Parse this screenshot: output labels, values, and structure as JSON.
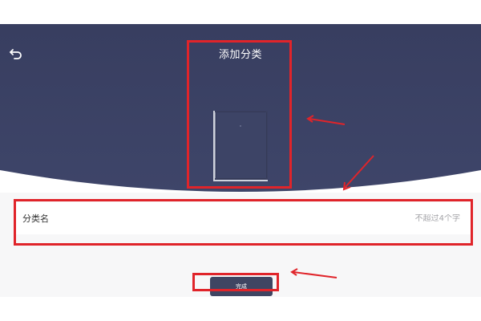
{
  "header": {
    "title": "添加分类",
    "back_icon": "back-arrow-icon",
    "colors": {
      "background_top": "#3a4062",
      "background_bottom": "#3d4468"
    }
  },
  "category_form": {
    "label": "分类名",
    "input_value": "",
    "placeholder": "不超过4个字"
  },
  "done_button": {
    "label": "完成",
    "color": "#3f4562"
  },
  "annotations": {
    "highlight_color": "#e0242a"
  }
}
